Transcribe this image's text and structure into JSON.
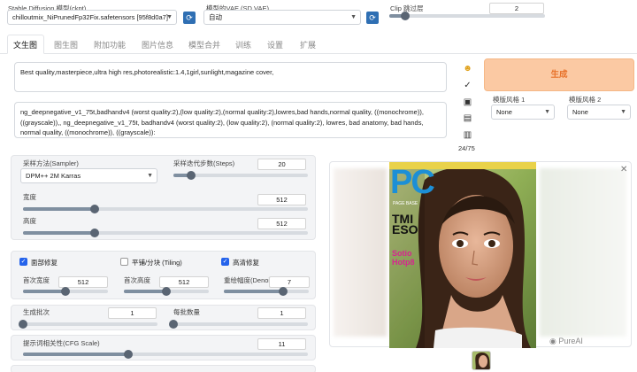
{
  "header": {
    "model_label": "Stable Diffusion 模型(ckpt)",
    "model_value": "chilloutmix_NiPrunedFp32Fix.safetensors [95f8d0a7]",
    "vae_label": "模型的VAE (SD VAE)",
    "vae_value": "自动",
    "clip_label": "Clip 跳过层",
    "clip_value": "2",
    "clip_level": 0.1
  },
  "tabs": [
    "文生图",
    "图生图",
    "附加功能",
    "图片信息",
    "模型合并",
    "训练",
    "设置",
    "扩展"
  ],
  "active_tab": 0,
  "prompt": {
    "positive": "Best quality,masterpiece,ultra high res,photorealistic:1.4,1girl,sunlight,magazine cover,",
    "negative": "ng_deepnegative_v1_75t,badhandv4 (worst quality:2),(low quality:2),(normal quality:2),lowres,bad hands,normal quality, ((monochrome)),((grayscale)),, ng_deepnegative_v1_75t, badhandv4 (worst quality:2), (low quality:2), (normal quality:2), lowres, bad anatomy, bad hands, normal quality, ((monochrome)), ((grayscale)):"
  },
  "tools": {
    "token_count": "24/75"
  },
  "generate": {
    "label": "生成",
    "style1_label": "模版风格 1",
    "style1_value": "None",
    "style2_label": "模版风格 2",
    "style2_value": "None"
  },
  "settings": {
    "sampler_label": "采样方法(Sampler)",
    "sampler_value": "DPM++ 2M Karras",
    "steps_label": "采样迭代步数(Steps)",
    "steps_value": "20",
    "steps_level": 0.13,
    "width_label": "宽度",
    "width_value": "512",
    "width_level": 0.25,
    "height_label": "高度",
    "height_value": "512",
    "height_level": 0.25,
    "face_fix_label": "面部修复",
    "face_fix_checked": true,
    "tiling_label": "平铺/分块 (Tiling)",
    "tiling_checked": false,
    "hires_label": "高清修复",
    "hires_checked": true,
    "first_width_label": "首次宽度",
    "first_width_value": "512",
    "first_width_level": 0.5,
    "first_height_label": "首次高度",
    "first_height_value": "512",
    "first_height_level": 0.5,
    "denoise_label": "重绘幅度(Denoising)",
    "denoise_value": "7",
    "denoise_level": 0.7,
    "batch_count_label": "生成批次",
    "batch_count_value": "1",
    "batch_count_level": 0.0,
    "batch_size_label": "每批数量",
    "batch_size_value": "1",
    "batch_size_level": 0.0,
    "cfg_label": "提示词相关性(CFG Scale)",
    "cfg_value": "11",
    "cfg_level": 0.37
  },
  "output": {
    "close_icon": "close-icon",
    "magazine_logo": "PC",
    "magazine_sub": "PAGE BASE",
    "cover_lines": [
      "TMI",
      "ESO",
      "Sotio",
      "Hotp8"
    ],
    "watermark": "PureAI"
  },
  "colors": {
    "accent": "#2563eb",
    "generate_bg": "#fbc9a3",
    "generate_text": "#e8722a",
    "icon_blue": "#2f6fb3"
  }
}
